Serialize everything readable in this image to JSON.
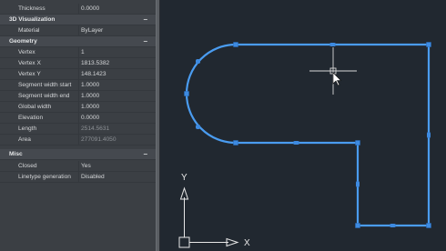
{
  "properties_panel": {
    "rows": [
      {
        "kind": "prop",
        "label": "Thickness",
        "value": "0.0000"
      },
      {
        "kind": "category",
        "label": "3D Visualization",
        "toggle": "−"
      },
      {
        "kind": "prop",
        "label": "Material",
        "value": "ByLayer"
      },
      {
        "kind": "category",
        "label": "Geometry",
        "toggle": "−"
      },
      {
        "kind": "prop",
        "label": "Vertex",
        "value": "1"
      },
      {
        "kind": "prop",
        "label": "Vertex X",
        "value": "1813.5382"
      },
      {
        "kind": "prop",
        "label": "Vertex Y",
        "value": "148.1423"
      },
      {
        "kind": "prop",
        "label": "Segment width start",
        "value": "1.0000"
      },
      {
        "kind": "prop",
        "label": "Segment width end",
        "value": "1.0000"
      },
      {
        "kind": "prop",
        "label": "Global width",
        "value": "1.0000"
      },
      {
        "kind": "prop",
        "label": "Elevation",
        "value": "0.0000"
      },
      {
        "kind": "prop",
        "label": "Length",
        "value": "2514.5631",
        "dim": true
      },
      {
        "kind": "prop",
        "label": "Area",
        "value": "277091.4050",
        "dim": true
      },
      {
        "kind": "category",
        "label": "Misc",
        "toggle": "−"
      },
      {
        "kind": "prop",
        "label": "Closed",
        "value": "Yes"
      },
      {
        "kind": "prop",
        "label": "Linetype generation",
        "value": "Disabled"
      }
    ]
  },
  "ucs_icon": {
    "y_label": "Y",
    "x_label": "X"
  },
  "colors": {
    "panel_bg": "#3b3f44",
    "category_bg": "#45494f",
    "canvas_bg": "#212830",
    "polyline": "#4a9cf0",
    "grip": "#3d8ae0"
  }
}
